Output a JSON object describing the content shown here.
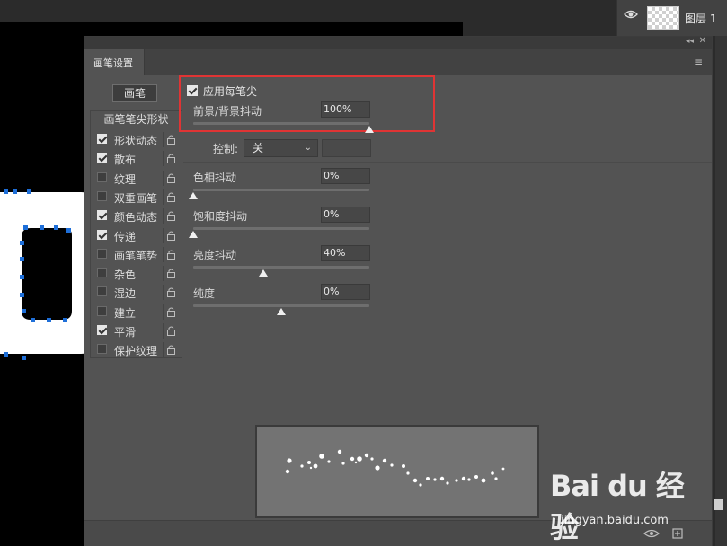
{
  "layers_panel": {
    "eye_icon": "eye-icon",
    "layer_name": "图层 1"
  },
  "panel": {
    "tab_label": "画笔设置",
    "collapse_glyph": "◂◂",
    "close_glyph": "✕",
    "menu_glyph": "≡",
    "brush_button_label": "画笔",
    "list_header": "画笔笔尖形状",
    "list_items": [
      {
        "label": "形状动态",
        "checked": true
      },
      {
        "label": "散布",
        "checked": true
      },
      {
        "label": "纹理",
        "checked": false
      },
      {
        "label": "双重画笔",
        "checked": false
      },
      {
        "label": "颜色动态",
        "checked": true
      },
      {
        "label": "传递",
        "checked": true
      },
      {
        "label": "画笔笔势",
        "checked": false
      },
      {
        "label": "杂色",
        "checked": false
      },
      {
        "label": "湿边",
        "checked": false
      },
      {
        "label": "建立",
        "checked": false
      },
      {
        "label": "平滑",
        "checked": true
      },
      {
        "label": "保护纹理",
        "checked": false
      }
    ],
    "apply_per_tip": {
      "label": "应用每笔尖",
      "checked": true
    },
    "fg_bg_jitter": {
      "label": "前景/背景抖动",
      "value": "100%",
      "level": 1.0
    },
    "control": {
      "label": "控制:",
      "value": "关"
    },
    "hue_jitter": {
      "label": "色相抖动",
      "value": "0%",
      "level": 0.0
    },
    "saturation_jitter": {
      "label": "饱和度抖动",
      "value": "0%",
      "level": 0.0
    },
    "brightness_jitter": {
      "label": "亮度抖动",
      "value": "40%",
      "level": 0.4
    },
    "purity": {
      "label": "纯度",
      "value": "0%",
      "level": 0.5
    }
  },
  "colors": {
    "panel_bg": "#535353",
    "highlight": "#e03434",
    "selection_handle": "#1e6fd9"
  },
  "watermark": {
    "brand": "Bai du 经验",
    "url": "jingyan.baidu.com"
  }
}
